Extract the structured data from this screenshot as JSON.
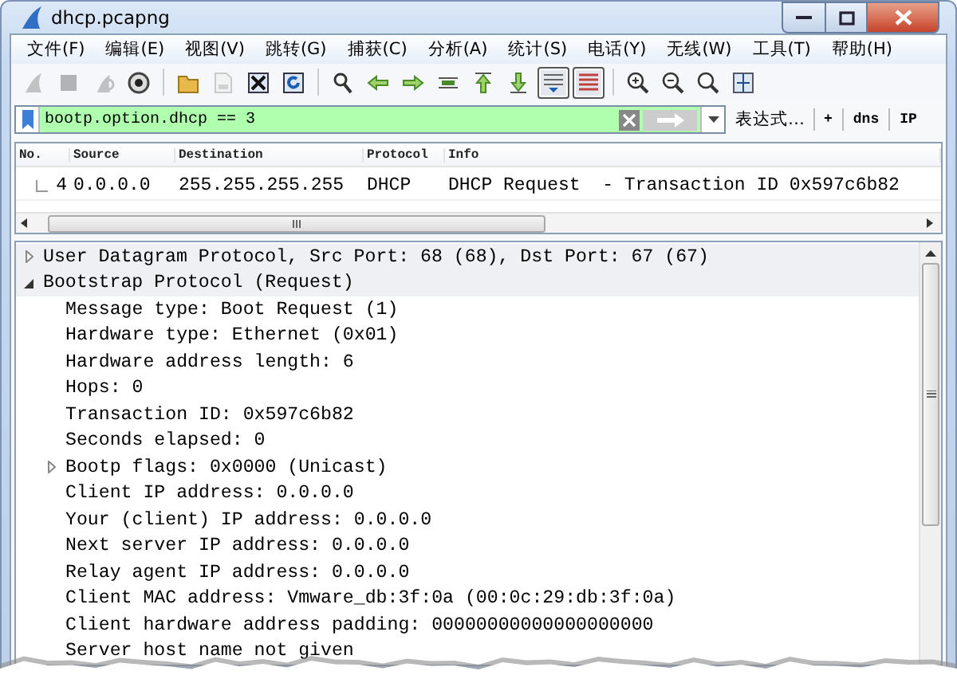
{
  "window": {
    "title": "dhcp.pcapng"
  },
  "menu": [
    {
      "label": "文件(F)"
    },
    {
      "label": "编辑(E)"
    },
    {
      "label": "视图(V)"
    },
    {
      "label": "跳转(G)"
    },
    {
      "label": "捕获(C)"
    },
    {
      "label": "分析(A)"
    },
    {
      "label": "统计(S)"
    },
    {
      "label": "电话(Y)"
    },
    {
      "label": "无线(W)"
    },
    {
      "label": "工具(T)"
    },
    {
      "label": "帮助(H)"
    }
  ],
  "toolbar": [
    {
      "kind": "fin",
      "disabled": true,
      "pressed": false
    },
    {
      "kind": "stop",
      "disabled": true,
      "pressed": false
    },
    {
      "kind": "restart",
      "disabled": true,
      "pressed": false
    },
    {
      "kind": "options",
      "disabled": false,
      "pressed": false
    },
    {
      "kind": "separator"
    },
    {
      "kind": "open",
      "disabled": false,
      "pressed": false
    },
    {
      "kind": "save",
      "disabled": true,
      "pressed": false
    },
    {
      "kind": "close",
      "disabled": false,
      "pressed": false
    },
    {
      "kind": "reload",
      "disabled": false,
      "pressed": false
    },
    {
      "kind": "separator"
    },
    {
      "kind": "find",
      "disabled": false,
      "pressed": false
    },
    {
      "kind": "back",
      "disabled": false,
      "pressed": false
    },
    {
      "kind": "forward",
      "disabled": false,
      "pressed": false
    },
    {
      "kind": "goto",
      "disabled": false,
      "pressed": false
    },
    {
      "kind": "first",
      "disabled": false,
      "pressed": false
    },
    {
      "kind": "last",
      "disabled": false,
      "pressed": false
    },
    {
      "kind": "autoscroll",
      "disabled": false,
      "pressed": true
    },
    {
      "kind": "colorize",
      "disabled": false,
      "pressed": true
    },
    {
      "kind": "separator"
    },
    {
      "kind": "zoomin",
      "disabled": false,
      "pressed": false
    },
    {
      "kind": "zoomout",
      "disabled": false,
      "pressed": false
    },
    {
      "kind": "zoomreset",
      "disabled": false,
      "pressed": false
    },
    {
      "kind": "resize",
      "disabled": false,
      "pressed": false
    }
  ],
  "filter": {
    "value": "bootp.option.dhcp == 3",
    "expression_label": "表达式…",
    "buttons": [
      {
        "label": "+"
      },
      {
        "label": "dns"
      },
      {
        "label": "IP"
      }
    ]
  },
  "packet_list": {
    "columns": [
      "No.",
      "Source",
      "Destination",
      "Protocol",
      "Info"
    ],
    "rows": [
      {
        "cells": [
          "4",
          "0.0.0.0",
          "255.255.255.255",
          "DHCP",
          "DHCP Request  - Transaction ID 0x597c6b82"
        ]
      }
    ]
  },
  "details": [
    {
      "text": "User Datagram Protocol, Src Port: 68 (68), Dst Port: 67 (67)",
      "expanded": false
    },
    {
      "text": "Bootstrap Protocol (Request)",
      "expanded": true,
      "children": [
        {
          "text": "Message type: Boot Request (1)"
        },
        {
          "text": "Hardware type: Ethernet (0x01)"
        },
        {
          "text": "Hardware address length: 6"
        },
        {
          "text": "Hops: 0"
        },
        {
          "text": "Transaction ID: 0x597c6b82"
        },
        {
          "text": "Seconds elapsed: 0"
        },
        {
          "text": "Bootp flags: 0x0000 (Unicast)",
          "expanded": false
        },
        {
          "text": "Client IP address: 0.0.0.0"
        },
        {
          "text": "Your (client) IP address: 0.0.0.0"
        },
        {
          "text": "Next server IP address: 0.0.0.0"
        },
        {
          "text": "Relay agent IP address: 0.0.0.0"
        },
        {
          "text": "Client MAC address: Vmware_db:3f:0a (00:0c:29:db:3f:0a)"
        },
        {
          "text": "Client hardware address padding: 00000000000000000000"
        },
        {
          "text": "Server host name not given"
        }
      ]
    }
  ]
}
